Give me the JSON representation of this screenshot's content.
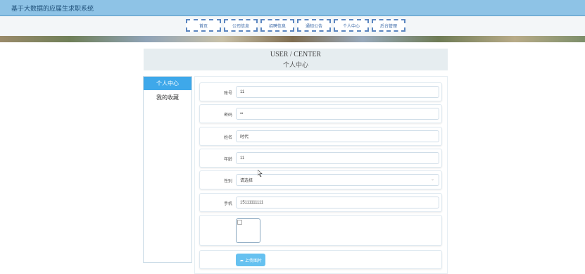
{
  "app": {
    "title": "基于大数据的应届生求职系统"
  },
  "nav": {
    "items": [
      {
        "label": "首页"
      },
      {
        "label": "公司信息"
      },
      {
        "label": "招聘信息"
      },
      {
        "label": "通知公告"
      },
      {
        "label": "个人中心"
      },
      {
        "label": "后台管理"
      }
    ]
  },
  "header": {
    "en": "USER / CENTER",
    "cn": "个人中心"
  },
  "sidebar": {
    "items": [
      {
        "label": "个人中心",
        "active": true
      },
      {
        "label": "我的收藏",
        "active": false
      }
    ]
  },
  "form": {
    "account": {
      "label": "账号",
      "value": "11"
    },
    "password": {
      "label": "密码",
      "value": "••"
    },
    "name": {
      "label": "姓名",
      "value": "时代"
    },
    "age": {
      "label": "年龄",
      "value": "11"
    },
    "gender": {
      "label": "性别",
      "value": "请选择"
    },
    "phone": {
      "label": "手机",
      "value": "15111111111"
    },
    "upload": {
      "label": "上传图片"
    }
  },
  "colors": {
    "topbar": "#8ec3e6",
    "accent": "#3ea8ea",
    "nav_border": "#5b86c0"
  }
}
